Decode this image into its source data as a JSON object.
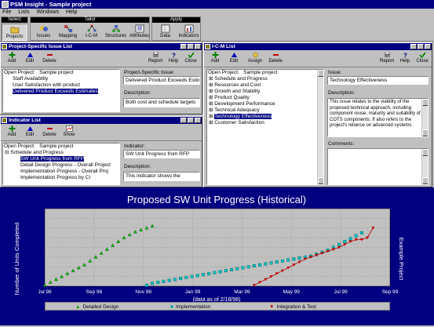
{
  "app": {
    "title": "PSM Insight - Sample project"
  },
  "menu": [
    "File",
    "Lists",
    "Windows",
    "Help"
  ],
  "toolbar": {
    "select_title": "Select",
    "tailor_title": "Tailor",
    "apply_title": "Apply",
    "projects": "Projects",
    "issues": "Issues",
    "mapping": "Mapping",
    "icm": "I-C-M",
    "structures": "Structures",
    "attributes": "Attributes",
    "data": "Data",
    "indicators": "Indicators"
  },
  "issue_list": {
    "title": "Project-Specific Issue List",
    "add": "Add",
    "edit": "Edit",
    "delete": "Delete",
    "report": "Report",
    "help": "Help",
    "close": "Close",
    "open_project": "Open Project:",
    "project_name": "Sample project",
    "items": [
      "Staff Availability",
      "User Satisfaction with product",
      "Delivered Product Exceeds Estimates"
    ],
    "issue_label": "Project-Specific Issue:",
    "issue_value": "Delivered Product Exceeds Estimate",
    "desc_label": "Description:",
    "desc_value": "Both cost and schedule targets"
  },
  "indicator_list": {
    "title": "Indicator List",
    "add": "Add",
    "edit": "Edit",
    "delete": "Delete",
    "show": "Show",
    "open_project": "Open Project:",
    "project_name": "Sample project",
    "items": [
      "Schedule and Progress",
      "SW Unit Progress from RFP",
      "Detail Design Progress - Overall Project",
      "Implementation Progress - Overall Proj",
      "Implementation Progress by CI"
    ],
    "indicator_label": "Indicator:",
    "indicator_value": "SW Unit Progress from RFP",
    "desc_label": "Description:",
    "desc_value": "This indicator shows the"
  },
  "icm_list": {
    "title": "I-C-M List",
    "add": "Add",
    "edit": "Edit",
    "assign": "Assign",
    "delete": "Delete",
    "report": "Report",
    "help": "Help",
    "close": "Close",
    "open_project": "Open Project:",
    "project_name": "Sample project",
    "items": [
      "Schedule and Progress",
      "Resources and Cost",
      "Growth and Stability",
      "Product Quality",
      "Development Performance",
      "Technical Adequacy",
      "Technology Effectiveness",
      "Customer Satisfaction"
    ],
    "issue_label": "Issue:",
    "issue_value": "Technology Effectiveness",
    "desc_label": "Description:",
    "desc_lines": [
      "This issue relates to the viability of the",
      "proposed technical approach, including",
      "component reuse, maturity and suitability of",
      "COTS components. If also refers to the",
      "project's reliance on advanced systems"
    ],
    "comments_label": "Comments:"
  },
  "chart_data": {
    "type": "line",
    "title": "Proposed SW Unit Progress (Historical)",
    "ylabel": "Number of Units Completed",
    "right_label": "Example Project",
    "xlabel": "(data as of 2/18/98)",
    "x_ticks": [
      "Jul 98",
      "Sep 98",
      "Nov 98",
      "Jan 99",
      "Mar 99",
      "May 99",
      "Jul 99",
      "Sep 99"
    ],
    "x_range": [
      "1998-07-01",
      "1999-09-01"
    ],
    "ylim": [
      0,
      80
    ],
    "grid": true,
    "series": [
      {
        "name": "Detailed Design",
        "marker": "triangle",
        "color": "#00c000",
        "points": [
          [
            "1998-07-01",
            1
          ],
          [
            "1998-07-08",
            4
          ],
          [
            "1998-07-15",
            7
          ],
          [
            "1998-07-22",
            10
          ],
          [
            "1998-07-29",
            13
          ],
          [
            "1998-08-05",
            16
          ],
          [
            "1998-08-12",
            19
          ],
          [
            "1998-08-19",
            22
          ],
          [
            "1998-08-26",
            26
          ],
          [
            "1998-09-02",
            30
          ],
          [
            "1998-09-09",
            34
          ],
          [
            "1998-09-16",
            38
          ],
          [
            "1998-09-23",
            42
          ],
          [
            "1998-09-30",
            46
          ],
          [
            "1998-10-07",
            50
          ],
          [
            "1998-10-14",
            53
          ],
          [
            "1998-10-21",
            56
          ],
          [
            "1998-10-28",
            58
          ],
          [
            "1998-11-04",
            60
          ],
          [
            "1998-11-11",
            62
          ]
        ]
      },
      {
        "name": "Implementation",
        "marker": "square",
        "color": "#00c0c0",
        "points": [
          [
            "1998-11-04",
            1
          ],
          [
            "1998-11-11",
            3
          ],
          [
            "1998-11-18",
            4
          ],
          [
            "1998-11-25",
            5
          ],
          [
            "1998-12-02",
            6
          ],
          [
            "1998-12-09",
            7
          ],
          [
            "1998-12-16",
            8
          ],
          [
            "1998-12-23",
            9
          ],
          [
            "1998-12-30",
            10
          ],
          [
            "1999-01-06",
            11
          ],
          [
            "1999-01-13",
            12
          ],
          [
            "1999-01-20",
            13
          ],
          [
            "1999-01-27",
            14
          ],
          [
            "1999-02-03",
            15
          ],
          [
            "1999-02-10",
            16
          ],
          [
            "1999-02-17",
            17
          ],
          [
            "1999-02-24",
            18
          ],
          [
            "1999-03-03",
            19
          ],
          [
            "1999-03-10",
            20
          ],
          [
            "1999-03-17",
            21
          ],
          [
            "1999-03-24",
            22
          ],
          [
            "1999-03-31",
            23
          ],
          [
            "1999-04-07",
            24
          ],
          [
            "1999-04-14",
            25
          ],
          [
            "1999-04-21",
            26
          ],
          [
            "1999-04-28",
            27
          ],
          [
            "1999-05-05",
            28
          ],
          [
            "1999-05-12",
            29
          ],
          [
            "1999-05-19",
            30
          ],
          [
            "1999-05-26",
            31
          ],
          [
            "1999-06-02",
            33
          ],
          [
            "1999-06-09",
            35
          ],
          [
            "1999-06-16",
            37
          ],
          [
            "1999-06-23",
            40
          ],
          [
            "1999-06-30",
            43
          ],
          [
            "1999-07-07",
            46
          ],
          [
            "1999-07-14",
            49
          ],
          [
            "1999-07-21",
            52
          ],
          [
            "1999-07-28",
            55
          ]
        ]
      },
      {
        "name": "Integration & Test",
        "marker": "triangle-down",
        "color": "#c00000",
        "points": [
          [
            "1999-03-17",
            1
          ],
          [
            "1999-03-24",
            4
          ],
          [
            "1999-03-31",
            7
          ],
          [
            "1999-04-07",
            10
          ],
          [
            "1999-04-14",
            13
          ],
          [
            "1999-04-21",
            16
          ],
          [
            "1999-04-28",
            19
          ],
          [
            "1999-05-05",
            22
          ],
          [
            "1999-05-12",
            25
          ],
          [
            "1999-05-19",
            28
          ],
          [
            "1999-05-26",
            30
          ],
          [
            "1999-06-02",
            32
          ],
          [
            "1999-06-09",
            34
          ],
          [
            "1999-06-16",
            36
          ],
          [
            "1999-06-23",
            38
          ],
          [
            "1999-06-30",
            40
          ],
          [
            "1999-07-07",
            43
          ],
          [
            "1999-07-14",
            46
          ],
          [
            "1999-07-21",
            48
          ],
          [
            "1999-07-28",
            48
          ],
          [
            "1999-08-04",
            50
          ],
          [
            "1999-08-11",
            60
          ]
        ]
      }
    ]
  }
}
